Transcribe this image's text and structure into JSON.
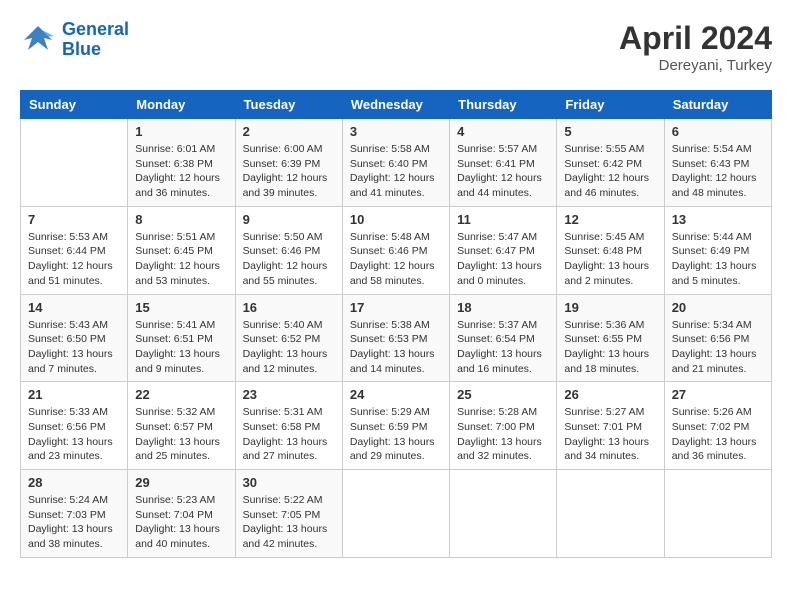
{
  "header": {
    "logo_line1": "General",
    "logo_line2": "Blue",
    "month": "April 2024",
    "location": "Dereyani, Turkey"
  },
  "weekdays": [
    "Sunday",
    "Monday",
    "Tuesday",
    "Wednesday",
    "Thursday",
    "Friday",
    "Saturday"
  ],
  "weeks": [
    [
      {
        "day": "",
        "info": ""
      },
      {
        "day": "1",
        "info": "Sunrise: 6:01 AM\nSunset: 6:38 PM\nDaylight: 12 hours\nand 36 minutes."
      },
      {
        "day": "2",
        "info": "Sunrise: 6:00 AM\nSunset: 6:39 PM\nDaylight: 12 hours\nand 39 minutes."
      },
      {
        "day": "3",
        "info": "Sunrise: 5:58 AM\nSunset: 6:40 PM\nDaylight: 12 hours\nand 41 minutes."
      },
      {
        "day": "4",
        "info": "Sunrise: 5:57 AM\nSunset: 6:41 PM\nDaylight: 12 hours\nand 44 minutes."
      },
      {
        "day": "5",
        "info": "Sunrise: 5:55 AM\nSunset: 6:42 PM\nDaylight: 12 hours\nand 46 minutes."
      },
      {
        "day": "6",
        "info": "Sunrise: 5:54 AM\nSunset: 6:43 PM\nDaylight: 12 hours\nand 48 minutes."
      }
    ],
    [
      {
        "day": "7",
        "info": "Sunrise: 5:53 AM\nSunset: 6:44 PM\nDaylight: 12 hours\nand 51 minutes."
      },
      {
        "day": "8",
        "info": "Sunrise: 5:51 AM\nSunset: 6:45 PM\nDaylight: 12 hours\nand 53 minutes."
      },
      {
        "day": "9",
        "info": "Sunrise: 5:50 AM\nSunset: 6:46 PM\nDaylight: 12 hours\nand 55 minutes."
      },
      {
        "day": "10",
        "info": "Sunrise: 5:48 AM\nSunset: 6:46 PM\nDaylight: 12 hours\nand 58 minutes."
      },
      {
        "day": "11",
        "info": "Sunrise: 5:47 AM\nSunset: 6:47 PM\nDaylight: 13 hours\nand 0 minutes."
      },
      {
        "day": "12",
        "info": "Sunrise: 5:45 AM\nSunset: 6:48 PM\nDaylight: 13 hours\nand 2 minutes."
      },
      {
        "day": "13",
        "info": "Sunrise: 5:44 AM\nSunset: 6:49 PM\nDaylight: 13 hours\nand 5 minutes."
      }
    ],
    [
      {
        "day": "14",
        "info": "Sunrise: 5:43 AM\nSunset: 6:50 PM\nDaylight: 13 hours\nand 7 minutes."
      },
      {
        "day": "15",
        "info": "Sunrise: 5:41 AM\nSunset: 6:51 PM\nDaylight: 13 hours\nand 9 minutes."
      },
      {
        "day": "16",
        "info": "Sunrise: 5:40 AM\nSunset: 6:52 PM\nDaylight: 13 hours\nand 12 minutes."
      },
      {
        "day": "17",
        "info": "Sunrise: 5:38 AM\nSunset: 6:53 PM\nDaylight: 13 hours\nand 14 minutes."
      },
      {
        "day": "18",
        "info": "Sunrise: 5:37 AM\nSunset: 6:54 PM\nDaylight: 13 hours\nand 16 minutes."
      },
      {
        "day": "19",
        "info": "Sunrise: 5:36 AM\nSunset: 6:55 PM\nDaylight: 13 hours\nand 18 minutes."
      },
      {
        "day": "20",
        "info": "Sunrise: 5:34 AM\nSunset: 6:56 PM\nDaylight: 13 hours\nand 21 minutes."
      }
    ],
    [
      {
        "day": "21",
        "info": "Sunrise: 5:33 AM\nSunset: 6:56 PM\nDaylight: 13 hours\nand 23 minutes."
      },
      {
        "day": "22",
        "info": "Sunrise: 5:32 AM\nSunset: 6:57 PM\nDaylight: 13 hours\nand 25 minutes."
      },
      {
        "day": "23",
        "info": "Sunrise: 5:31 AM\nSunset: 6:58 PM\nDaylight: 13 hours\nand 27 minutes."
      },
      {
        "day": "24",
        "info": "Sunrise: 5:29 AM\nSunset: 6:59 PM\nDaylight: 13 hours\nand 29 minutes."
      },
      {
        "day": "25",
        "info": "Sunrise: 5:28 AM\nSunset: 7:00 PM\nDaylight: 13 hours\nand 32 minutes."
      },
      {
        "day": "26",
        "info": "Sunrise: 5:27 AM\nSunset: 7:01 PM\nDaylight: 13 hours\nand 34 minutes."
      },
      {
        "day": "27",
        "info": "Sunrise: 5:26 AM\nSunset: 7:02 PM\nDaylight: 13 hours\nand 36 minutes."
      }
    ],
    [
      {
        "day": "28",
        "info": "Sunrise: 5:24 AM\nSunset: 7:03 PM\nDaylight: 13 hours\nand 38 minutes."
      },
      {
        "day": "29",
        "info": "Sunrise: 5:23 AM\nSunset: 7:04 PM\nDaylight: 13 hours\nand 40 minutes."
      },
      {
        "day": "30",
        "info": "Sunrise: 5:22 AM\nSunset: 7:05 PM\nDaylight: 13 hours\nand 42 minutes."
      },
      {
        "day": "",
        "info": ""
      },
      {
        "day": "",
        "info": ""
      },
      {
        "day": "",
        "info": ""
      },
      {
        "day": "",
        "info": ""
      }
    ]
  ]
}
